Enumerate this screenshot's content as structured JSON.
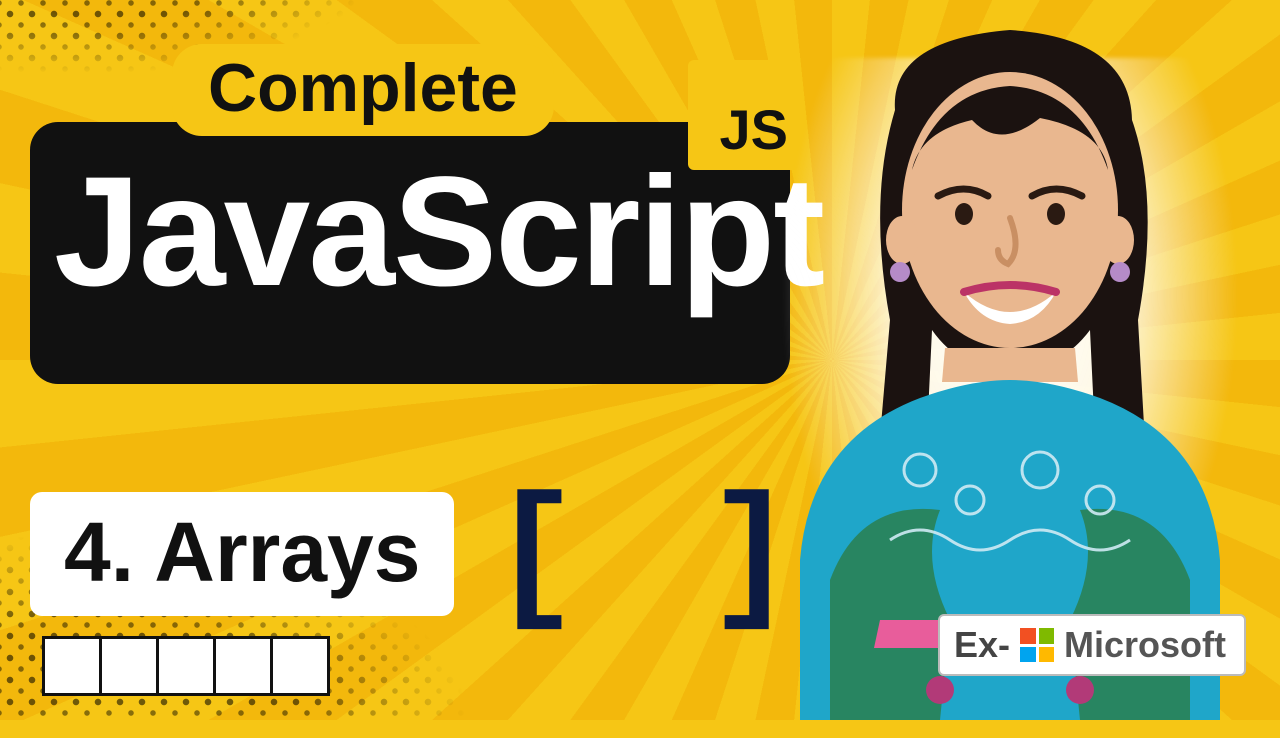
{
  "badge": {
    "complete": "Complete",
    "js": "JS"
  },
  "title": "JavaScript",
  "chapter": {
    "label": "4. Arrays",
    "brackets": "[ ]"
  },
  "array_cell_count": 5,
  "credential": {
    "prefix": "Ex-",
    "company": "Microsoft"
  }
}
